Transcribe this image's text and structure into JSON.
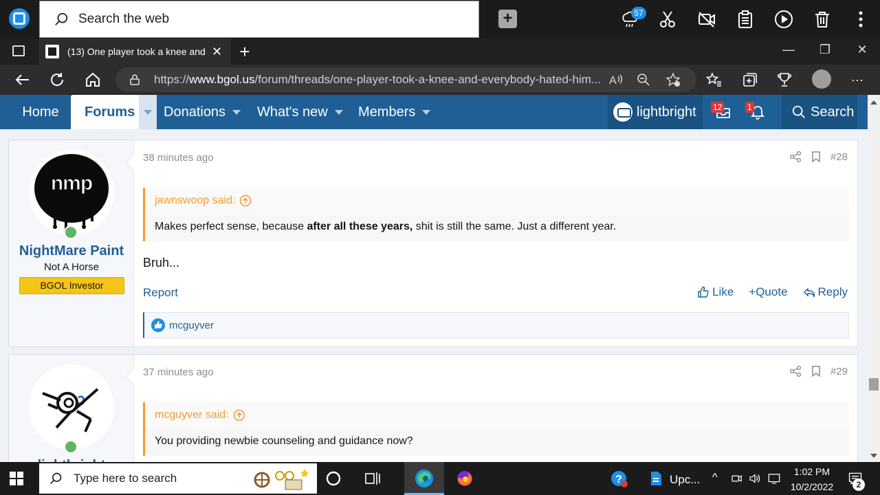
{
  "topbar": {
    "search_placeholder": "Search the web",
    "weather_badge": "57",
    "icons": [
      "weather-icon",
      "scissors-icon",
      "no-video-icon",
      "clipboard-icon",
      "play-icon",
      "trash-icon",
      "more-vertical-icon"
    ]
  },
  "browser": {
    "tab_title": "(13) One player took a knee and",
    "url_prefix": "https://",
    "url_domain": "www.bgol.us",
    "url_path": "/forum/threads/one-player-took-a-knee-and-everybody-hated-him..."
  },
  "forum_nav": {
    "home": "Home",
    "forums": "Forums",
    "donations": "Donations",
    "whats_new": "What's new",
    "members": "Members",
    "username": "lightbright",
    "inbox_count": "12",
    "alert_count": "1",
    "search": "Search"
  },
  "posts": [
    {
      "author": "NightMare Paint",
      "user_title": "Not A Horse",
      "banner": "BGOL Investor",
      "time": "38 minutes ago",
      "number": "#28",
      "quote_author": "jawnswoop said:",
      "quote_pre": "Makes perfect sense, because ",
      "quote_bold": "after all these years,",
      "quote_post": " shit is still the same. Just a different year.",
      "text": "Bruh...",
      "report": "Report",
      "like": "Like",
      "quote": "+Quote",
      "reply": "Reply",
      "liked_by": "mcguyver"
    },
    {
      "author": "lightbright",
      "time": "37 minutes ago",
      "number": "#29",
      "quote_author": "mcguyver said:",
      "quote_text": "You providing newbie counseling and guidance now?"
    }
  ],
  "taskbar": {
    "search_placeholder": "Type here to search",
    "app_label": "Upc...",
    "time": "1:02 PM",
    "date": "10/2/2022",
    "notification_count": "2"
  },
  "colors": {
    "forum_blue": "#1f5f95",
    "quote_orange": "#f59a2f",
    "banner_yellow": "#f5c518",
    "online_green": "#5fb55f"
  }
}
